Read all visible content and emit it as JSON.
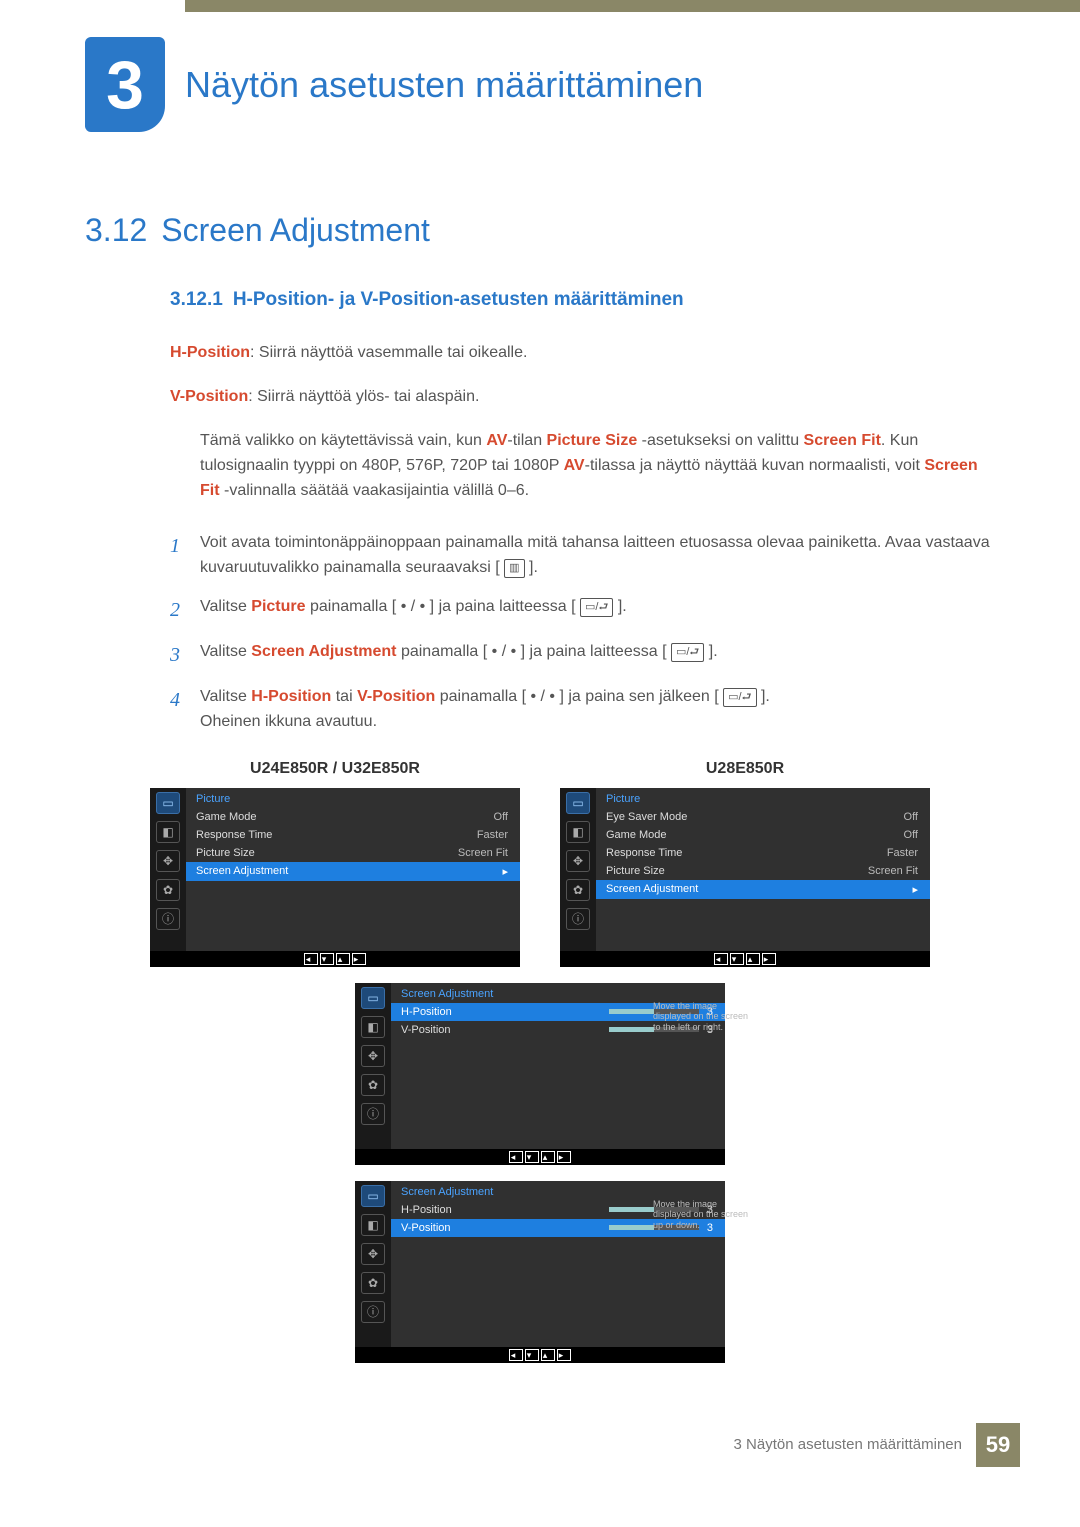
{
  "chapter": {
    "number": "3",
    "title": "Näytön asetusten määrittäminen"
  },
  "section": {
    "number": "3.12",
    "title": "Screen Adjustment"
  },
  "subsection": {
    "number": "3.12.1",
    "title": "H-Position- ja V-Position-asetusten määrittäminen"
  },
  "definitions": {
    "hpos_label": "H-Position",
    "hpos_text": ": Siirrä näyttöä vasemmalle tai oikealle.",
    "vpos_label": "V-Position",
    "vpos_text": ": Siirrä näyttöä ylös- tai alaspäin."
  },
  "info": {
    "p1a": "Tämä valikko on käytettävissä vain, kun ",
    "av1": "AV",
    "p1b": "-tilan ",
    "ps": "Picture Size",
    "p1c": " -asetukseksi on valittu ",
    "sf": "Screen Fit",
    "p1d": ". Kun tulosignaalin tyyppi on 480P, 576P, 720P tai 1080P ",
    "av2": "AV",
    "p1e": "-tilassa ja näyttö näyttää kuvan normaalisti, voit ",
    "sf2": "Screen Fit",
    "p1f": " -valinnalla säätää vaakasijaintia välillä 0–6."
  },
  "steps": {
    "s1n": "1",
    "s1": "Voit avata toimintonäppäinoppaan painamalla mitä tahansa laitteen etuosassa olevaa painiketta. Avaa vastaava kuvaruutuvalikko painamalla seuraavaksi [",
    "s1end": "].",
    "s2n": "2",
    "s2a": "Valitse ",
    "s2b": "Picture",
    "s2c": " painamalla [ • / • ] ja paina laitteessa [",
    "s2end": "].",
    "s3n": "3",
    "s3a": "Valitse ",
    "s3b": "Screen Adjustment",
    "s3c": " painamalla [ • / • ] ja paina laitteessa [",
    "s3end": "].",
    "s4n": "4",
    "s4a": "Valitse ",
    "s4b": "H-Position",
    "s4c": " tai ",
    "s4d": "V-Position",
    "s4e": " painamalla [ • / • ] ja paina sen jälkeen [",
    "s4end": "].",
    "s4f": "Oheinen ikkuna avautuu."
  },
  "model_labels": {
    "left": "U24E850R / U32E850R",
    "right": "U28E850R"
  },
  "osd_a": {
    "title": "Picture",
    "rows": [
      {
        "label": "Game Mode",
        "value": "Off"
      },
      {
        "label": "Response Time",
        "value": "Faster"
      },
      {
        "label": "Picture Size",
        "value": "Screen Fit"
      },
      {
        "label": "Screen Adjustment",
        "value": ""
      }
    ]
  },
  "osd_b": {
    "title": "Picture",
    "rows": [
      {
        "label": "Eye Saver Mode",
        "value": "Off"
      },
      {
        "label": "Game Mode",
        "value": "Off"
      },
      {
        "label": "Response Time",
        "value": "Faster"
      },
      {
        "label": "Picture Size",
        "value": "Screen Fit"
      },
      {
        "label": "Screen Adjustment",
        "value": ""
      }
    ]
  },
  "osd_c": {
    "title": "Screen Adjustment",
    "hp": "H-Position",
    "hpv": "3",
    "vp": "V-Position",
    "vpv": "3",
    "tip": "Move the image displayed on the screen to the left or right."
  },
  "osd_d": {
    "title": "Screen Adjustment",
    "hp": "H-Position",
    "hpv": "3",
    "vp": "V-Position",
    "vpv": "3",
    "tip": "Move the image displayed on the screen up or down."
  },
  "footer": {
    "text": "3 Näytön asetusten määrittäminen",
    "page": "59"
  }
}
